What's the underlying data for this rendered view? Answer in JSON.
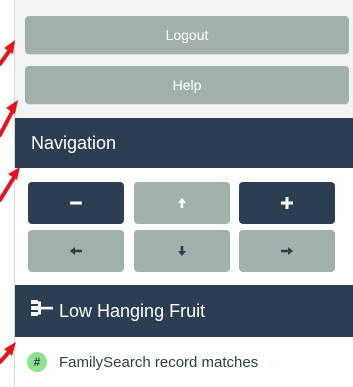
{
  "buttons": {
    "logout": "Logout",
    "help": "Help"
  },
  "navigation": {
    "title": "Navigation",
    "controls": [
      {
        "name": "zoom-out",
        "icon": "minus-icon"
      },
      {
        "name": "pan-up",
        "icon": "arrow-up-icon"
      },
      {
        "name": "zoom-in",
        "icon": "plus-icon"
      },
      {
        "name": "pan-left",
        "icon": "arrow-left-icon"
      },
      {
        "name": "pan-down",
        "icon": "arrow-down-icon"
      },
      {
        "name": "pan-right",
        "icon": "arrow-right-icon"
      }
    ]
  },
  "low_hanging_fruit": {
    "title": "Low Hanging Fruit",
    "icon": "tree-icon",
    "items": [
      {
        "badge": "#",
        "label": "FamilySearch record matches"
      }
    ]
  },
  "colors": {
    "button_gray": "#9fb1a9",
    "header_dark": "#2c3e50",
    "badge_green": "#8fe38f",
    "annotation_red": "#e8121c"
  }
}
